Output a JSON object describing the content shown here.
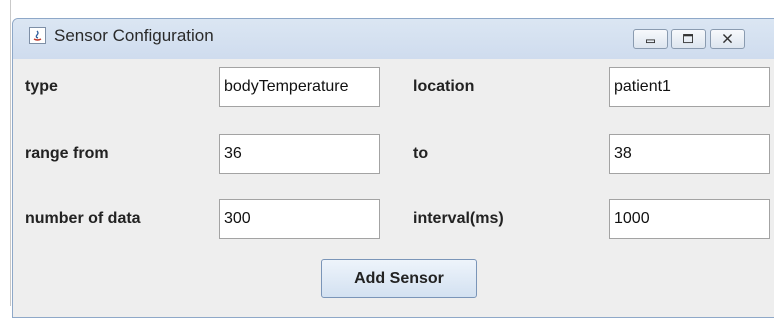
{
  "window": {
    "title": "Sensor Configuration",
    "icon": "java-app-icon",
    "controls": [
      "minimize-icon",
      "maximize-icon",
      "close-icon"
    ]
  },
  "form": {
    "type_label": "type",
    "type_value": "bodyTemperature",
    "location_label": "location",
    "location_value": "patient1",
    "range_from_label": "range from",
    "range_from_value": "36",
    "to_label": "to",
    "to_value": "38",
    "number_of_data_label": "number of data",
    "number_of_data_value": "300",
    "interval_label": "interval(ms)",
    "interval_value": "1000"
  },
  "actions": {
    "add_sensor_label": "Add Sensor"
  }
}
